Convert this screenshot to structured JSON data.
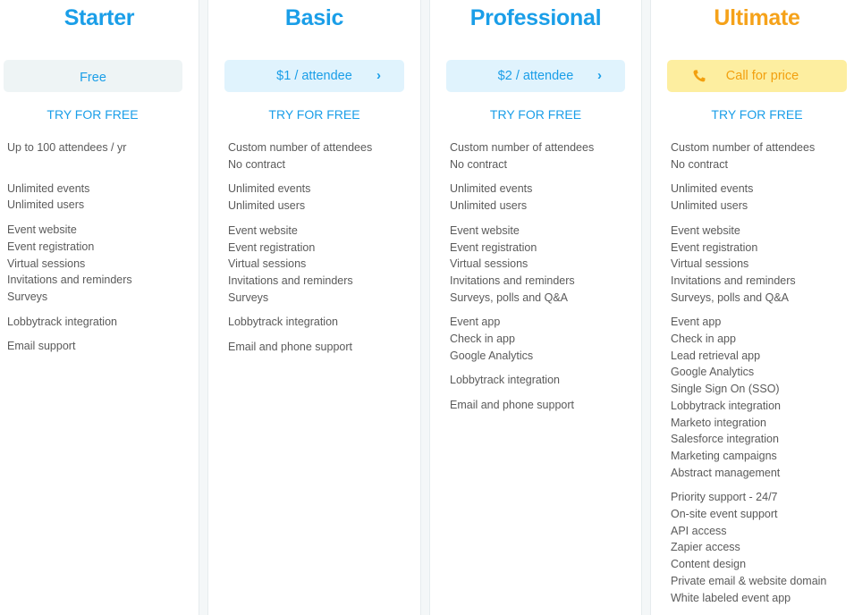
{
  "plans": [
    {
      "name": "Starter",
      "price_label": "Free",
      "cta": "TRY FOR FREE",
      "feature_groups": [
        [
          "Up to 100 attendees / yr"
        ],
        [
          "Unlimited events",
          "Unlimited users"
        ],
        [
          "Event website",
          "Event registration",
          "Virtual sessions",
          "Invitations and reminders",
          "Surveys"
        ],
        [
          "Lobbytrack integration"
        ],
        [
          "Email support"
        ]
      ]
    },
    {
      "name": "Basic",
      "price_label": "$1 / attendee",
      "cta": "TRY FOR FREE",
      "feature_groups": [
        [
          "Custom number of attendees",
          "No contract"
        ],
        [
          "Unlimited events",
          "Unlimited users"
        ],
        [
          "Event website",
          "Event registration",
          "Virtual sessions",
          "Invitations and reminders",
          "Surveys"
        ],
        [
          "Lobbytrack integration"
        ],
        [
          "Email and phone support"
        ]
      ]
    },
    {
      "name": "Professional",
      "price_label": "$2 / attendee",
      "cta": "TRY FOR FREE",
      "feature_groups": [
        [
          "Custom number of attendees",
          "No contract"
        ],
        [
          "Unlimited events",
          "Unlimited users"
        ],
        [
          "Event website",
          "Event registration",
          "Virtual sessions",
          "Invitations and reminders",
          "Surveys, polls and Q&A"
        ],
        [
          "Event app",
          "Check in app",
          "Google Analytics"
        ],
        [
          "Lobbytrack integration"
        ],
        [
          "Email and phone support"
        ]
      ]
    },
    {
      "name": "Ultimate",
      "price_label": "Call for price",
      "cta": "TRY FOR FREE",
      "feature_groups": [
        [
          "Custom number of attendees",
          "No contract"
        ],
        [
          "Unlimited events",
          "Unlimited users"
        ],
        [
          "Event website",
          "Event registration",
          "Virtual sessions",
          "Invitations and reminders",
          "Surveys, polls and Q&A"
        ],
        [
          "Event app",
          "Check in app",
          "Lead retrieval app",
          "Google Analytics",
          "Single Sign On (SSO)",
          "Lobbytrack integration",
          "Marketo integration",
          "Salesforce integration",
          "Marketing campaigns",
          "Abstract management"
        ],
        [
          "Priority support - 24/7",
          "On-site event support",
          "API access",
          "Zapier access",
          "Content design",
          "Private email & website domain",
          "White labeled event app"
        ]
      ]
    }
  ],
  "icons": {
    "chevron": "chevron-right-icon",
    "phone": "phone-icon"
  },
  "colors": {
    "accent_blue": "#1a9ee8",
    "accent_orange": "#f5a21a",
    "price_yellow_bg": "#fdeea0",
    "price_blue_bg": "#e0f3fd",
    "price_free_bg": "#eef4f5"
  }
}
